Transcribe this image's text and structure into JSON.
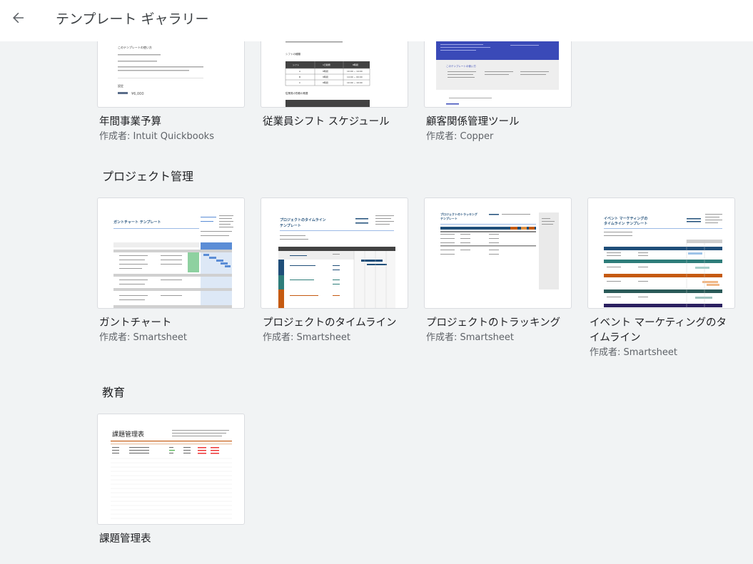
{
  "header": {
    "title": "テンプレート ギャラリー"
  },
  "top_row": [
    {
      "title": "年間事業予算",
      "author": "作成者: Intuit Quickbooks",
      "thumb_text": [
        "このテンプレートの使い方",
        "¥6,000",
        "設定"
      ]
    },
    {
      "title": "従業員シフト スケジュール",
      "author": "",
      "thumb_text": [
        "シフトの種類",
        "シフト",
        "1日勤務",
        "8時間",
        "10:00 ~ 14:00",
        "14:00 ~ 00:00",
        "10:00 ~ 19:00",
        "A",
        "B",
        "C",
        "従業員の勤務の概要"
      ]
    },
    {
      "title": "顧客関係管理ツール",
      "author": "作成者: Copper",
      "thumb_text": [
        "このテンプレートの使い方"
      ]
    }
  ],
  "sections": [
    {
      "title": "プロジェクト管理",
      "cards": [
        {
          "title": "ガントチャート",
          "author": "作成者: Smartsheet",
          "thumb_text": [
            "ガントチャート テンプレート"
          ]
        },
        {
          "title": "プロジェクトのタイムライン",
          "author": "作成者: Smartsheet",
          "thumb_text": [
            "プロジェクトのタイムライン",
            "テンプレート"
          ]
        },
        {
          "title": "プロジェクトのトラッキング",
          "author": "作成者: Smartsheet",
          "thumb_text": [
            "プロジェクトのトラッキング",
            "テンプレート"
          ]
        },
        {
          "title": "イベント マーケティングのタイムライン",
          "author": "作成者: Smartsheet",
          "thumb_text": [
            "イベント マーケティングの",
            "タイムライン テンプレート"
          ]
        }
      ]
    },
    {
      "title": "教育",
      "cards": [
        {
          "title": "課題管理表",
          "author": "",
          "thumb_text": [
            "課題管理表"
          ]
        }
      ]
    }
  ],
  "colors": {
    "background": "#f1f3f4",
    "header_bg": "#ffffff",
    "blue_accent": "#3a4ab8",
    "gantt_blue": "#5b8dd6",
    "gantt_green": "#4caf50",
    "timeline_navy": "#1f4e79",
    "timeline_teal": "#2e7d7a",
    "timeline_orange": "#c55a11"
  }
}
